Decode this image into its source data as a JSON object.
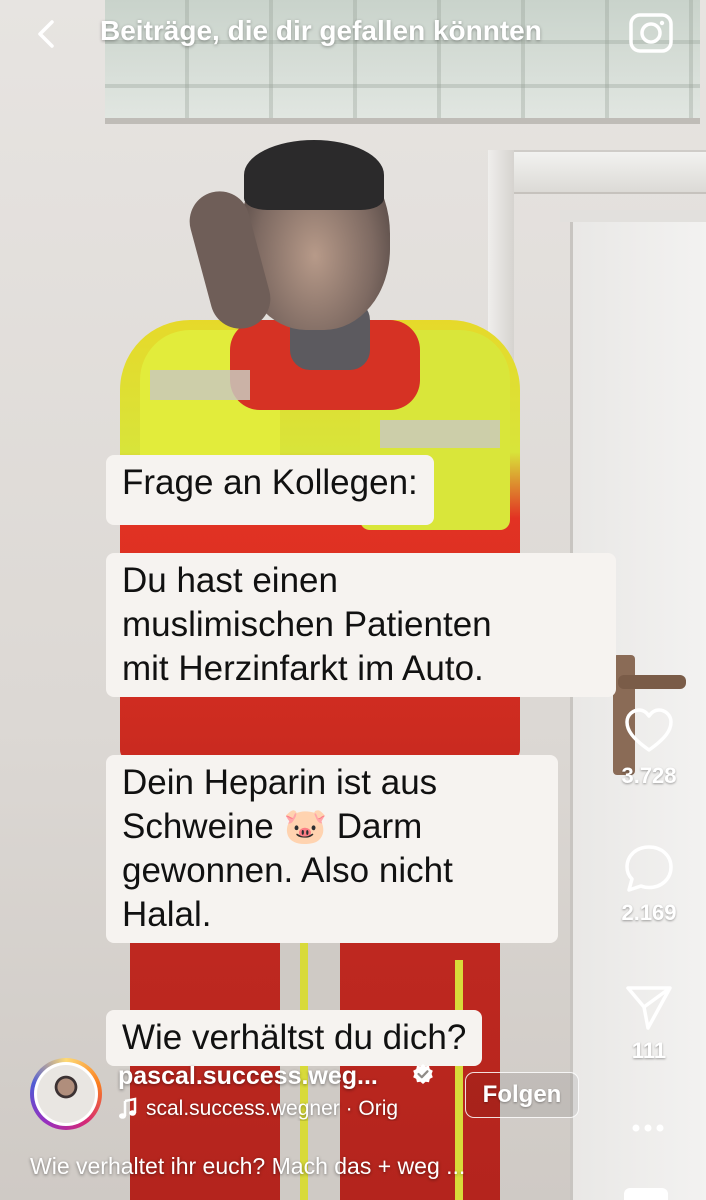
{
  "header": {
    "title": "Beiträge, die dir gefallen könnten",
    "back_icon": "chevron-left-icon",
    "camera_icon": "camera-icon"
  },
  "overlay_text": {
    "bubble1": "Frage an Kollegen:",
    "bubble2_lines": [
      "Du hast einen",
      "muslimischen Patienten",
      "mit Herzinfarkt im Auto."
    ],
    "bubble3_lines": [
      "Dein Heparin ist aus",
      "Schweine 🐷 Darm",
      "gewonnen. Also nicht",
      "Halal."
    ],
    "bubble4": "Wie verhältst du dich?"
  },
  "actions": {
    "like_count": "3.728",
    "comment_count": "2.169",
    "share_count": "111",
    "more_icon": "more-horizontal-icon"
  },
  "post": {
    "username": "pascal.success.weg...",
    "verified": true,
    "audio": "scal.success.wegner · Orig",
    "follow_label": "Folgen",
    "caption": "Wie verhaltet ihr euch? Mach das + weg ..."
  },
  "colors": {
    "text_primary": "#ffffff",
    "bubble_bg": "#f6f3f0",
    "bubble_text": "#111111"
  }
}
